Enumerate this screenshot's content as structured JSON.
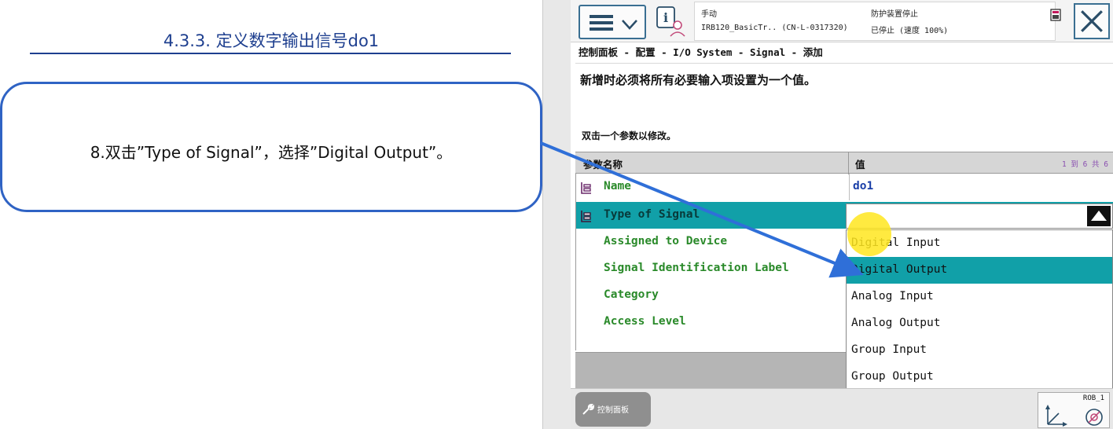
{
  "slide": {
    "title": "4.3.3. 定义数字输出信号do1",
    "callout_text": "8.双击”Type of Signal”，选择”Digital Output”。"
  },
  "pendant": {
    "status": {
      "mode": "手动",
      "robot": "IRB120_BasicTr.. (CN-L-0317320)",
      "guard": "防护装置停止",
      "state": "已停止 (速度 100%)"
    },
    "breadcrumb": "控制面板 - 配置 - I/O System - Signal - 添加",
    "instruction": "新增时必须将所有必要输入项设置为一个值。",
    "hint": "双击一个参数以修改。",
    "table": {
      "header_name": "参数名称",
      "header_value": "值",
      "pagination": "1 到 6 共 6",
      "rows": [
        {
          "name": "Name",
          "value": "do1"
        },
        {
          "name": "Type of Signal",
          "value": ""
        },
        {
          "name": "Assigned to Device",
          "value": ""
        },
        {
          "name": "Signal Identification Label",
          "value": ""
        },
        {
          "name": "Category",
          "value": ""
        },
        {
          "name": "Access Level",
          "value": ""
        }
      ]
    },
    "dropdown": {
      "selected": "",
      "options": [
        "Digital Input",
        "Digital Output",
        "Analog Input",
        "Analog Output",
        "Group Input",
        "Group Output"
      ],
      "highlighted": "Digital Output"
    },
    "taskbar": {
      "button_label": "控制面板"
    },
    "rob_widget": {
      "label": "ROB_1"
    },
    "colors": {
      "selection": "#11a0a8",
      "param_text": "#2a8a2a",
      "value_text": "#1a3fa8",
      "slide_blue": "#1e3f8f",
      "arrow_blue": "#2f6fd8"
    }
  }
}
